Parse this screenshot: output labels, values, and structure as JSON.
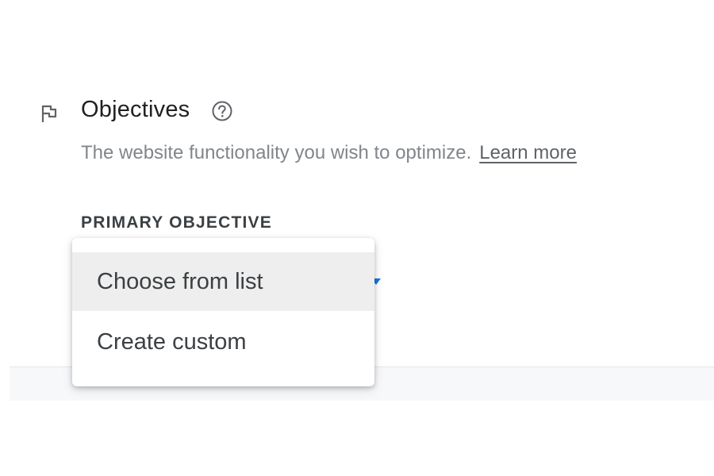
{
  "section": {
    "title": "Objectives",
    "help_icon": "help-circle-icon",
    "flag_icon": "flag-icon",
    "description": "The website functionality you wish to optimize.",
    "learn_more": "Learn more"
  },
  "primary_objective": {
    "label": "PRIMARY OBJECTIVE",
    "caret_icon": "caret-down-icon",
    "menu_items": [
      {
        "label": "Choose from list",
        "highlighted": true
      },
      {
        "label": "Create custom",
        "highlighted": false
      }
    ]
  },
  "colors": {
    "accent": "#1a73e8",
    "title_text": "#202124",
    "secondary_text": "#80868b",
    "highlight_bg": "#eeeeee"
  }
}
